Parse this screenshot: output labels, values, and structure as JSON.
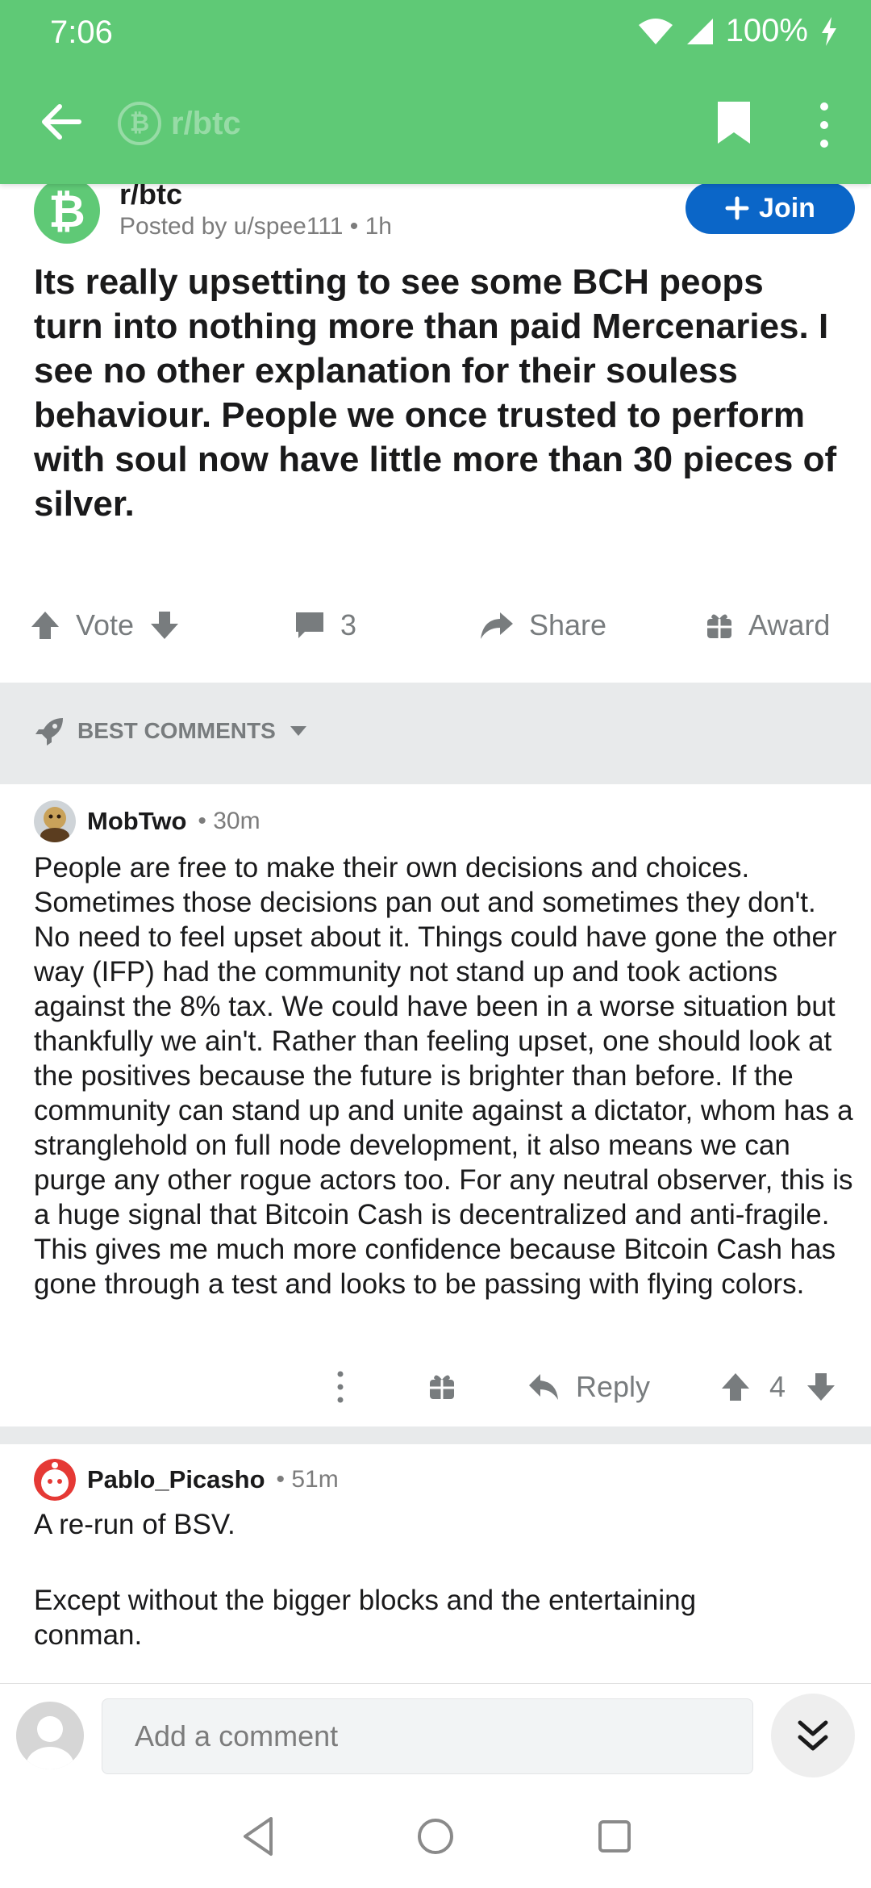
{
  "status": {
    "time": "7:06",
    "battery": "100%"
  },
  "appbar": {
    "subreddit": "r/btc"
  },
  "post": {
    "subreddit": "r/btc",
    "meta": "Posted by u/spee111 • 1h",
    "join_label": "Join",
    "title": "Its really upsetting to see some BCH peops turn into nothing more than paid Mercenaries. I see no other explanation for their souless behaviour. People we once trusted to perform with soul now have little more than 30 pieces of silver.",
    "vote_label": "Vote",
    "comment_count": "3",
    "share_label": "Share",
    "award_label": "Award"
  },
  "sort": {
    "label": "BEST COMMENTS"
  },
  "comments": [
    {
      "author": "MobTwo",
      "time": "• 30m",
      "body": "People are free to make their own decisions and choices. Sometimes those decisions pan out and sometimes they don't. No need to feel upset about it. Things could have gone the other way (IFP) had the community not stand up and took actions against the 8% tax. We could have been in a worse situation but thankfully we ain't. Rather than feeling upset, one should look at the positives because the future is brighter than before. If the community can stand up and unite against a dictator, whom has a stranglehold on full node development, it also means we can purge any other rogue actors too. For any neutral observer, this is a huge signal that Bitcoin Cash is decentralized and anti-fragile. This gives me much more confidence because Bitcoin Cash has gone through a test and looks to be passing with flying colors.",
      "reply_label": "Reply",
      "score": "4"
    },
    {
      "author": "Pablo_Picasho",
      "time": "• 51m",
      "body_line1": "A re-run of BSV.",
      "body_line2": "Except without the bigger blocks and the entertaining conman."
    }
  ],
  "composer": {
    "placeholder": "Add a comment"
  },
  "colors": {
    "brand_green": "#5fc976",
    "join_blue": "#0b66c8",
    "gray_bg": "#e8eaeb"
  }
}
